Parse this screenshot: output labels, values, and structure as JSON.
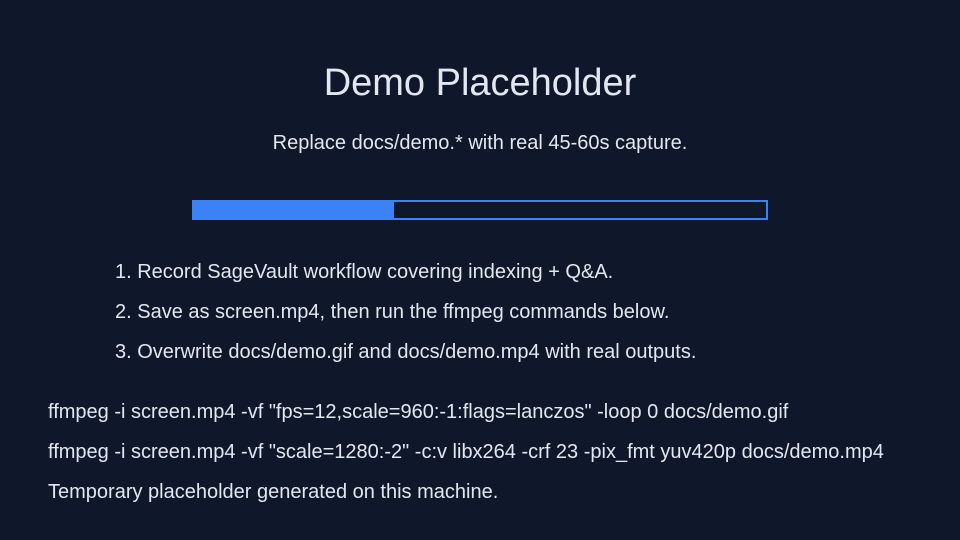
{
  "title": "Demo Placeholder",
  "subtitle": "Replace docs/demo.* with real 45-60s capture.",
  "progress": {
    "fraction": 0.35,
    "track_color": "#3b82f6",
    "fill_color": "#3b82f6"
  },
  "steps": [
    "1. Record SageVault workflow covering indexing + Q&A.",
    "2. Save as screen.mp4, then run the ffmpeg commands below.",
    "3. Overwrite docs/demo.gif and docs/demo.mp4 with real outputs."
  ],
  "commands": [
    "ffmpeg -i screen.mp4 -vf \"fps=12,scale=960:-1:flags=lanczos\" -loop 0 docs/demo.gif",
    "ffmpeg -i screen.mp4 -vf \"scale=1280:-2\" -c:v libx264 -crf 23 -pix_fmt yuv420p docs/demo.mp4"
  ],
  "footer": "Temporary placeholder generated on this machine.",
  "colors": {
    "background": "#0f172a",
    "text": "#e2e8f0",
    "accent": "#3b82f6"
  }
}
